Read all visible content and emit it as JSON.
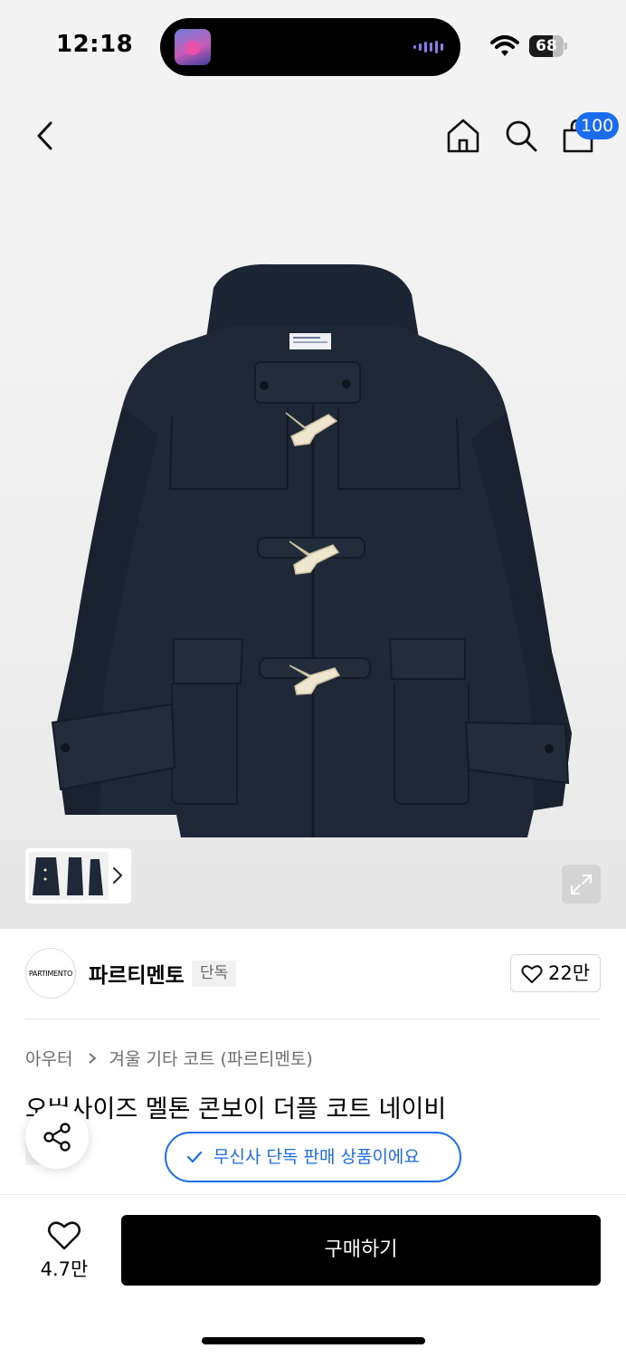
{
  "status_bar": {
    "time": "12:18",
    "battery": "68",
    "battery_level": 0.68
  },
  "nav": {
    "cart_count": "100"
  },
  "product": {
    "brand": {
      "logo_text": "PARTIMENTO",
      "name": "파르티멘토",
      "tag": "단독",
      "likes": "22만"
    },
    "breadcrumb": [
      "아우터",
      "겨울 기타 코트 (파르티멘토)"
    ],
    "title": "오버사이즈 멜톤 콘보이 더플 코트 네이비",
    "exclusive_chip": "단독",
    "exclusive_notice": "무신사 단독 판매 상품이에요"
  },
  "bottom_bar": {
    "like_count": "4.7만",
    "buy_label": "구매하기"
  },
  "colors": {
    "accent_blue": "#1a6cf0",
    "coat_navy": "#1f2836",
    "toggle_ivory": "#efe6cf"
  },
  "icons": [
    "back-icon",
    "home-icon",
    "search-icon",
    "cart-icon",
    "chevron-right-icon",
    "expand-icon",
    "heart-icon",
    "share-icon",
    "check-icon",
    "wifi-icon"
  ]
}
